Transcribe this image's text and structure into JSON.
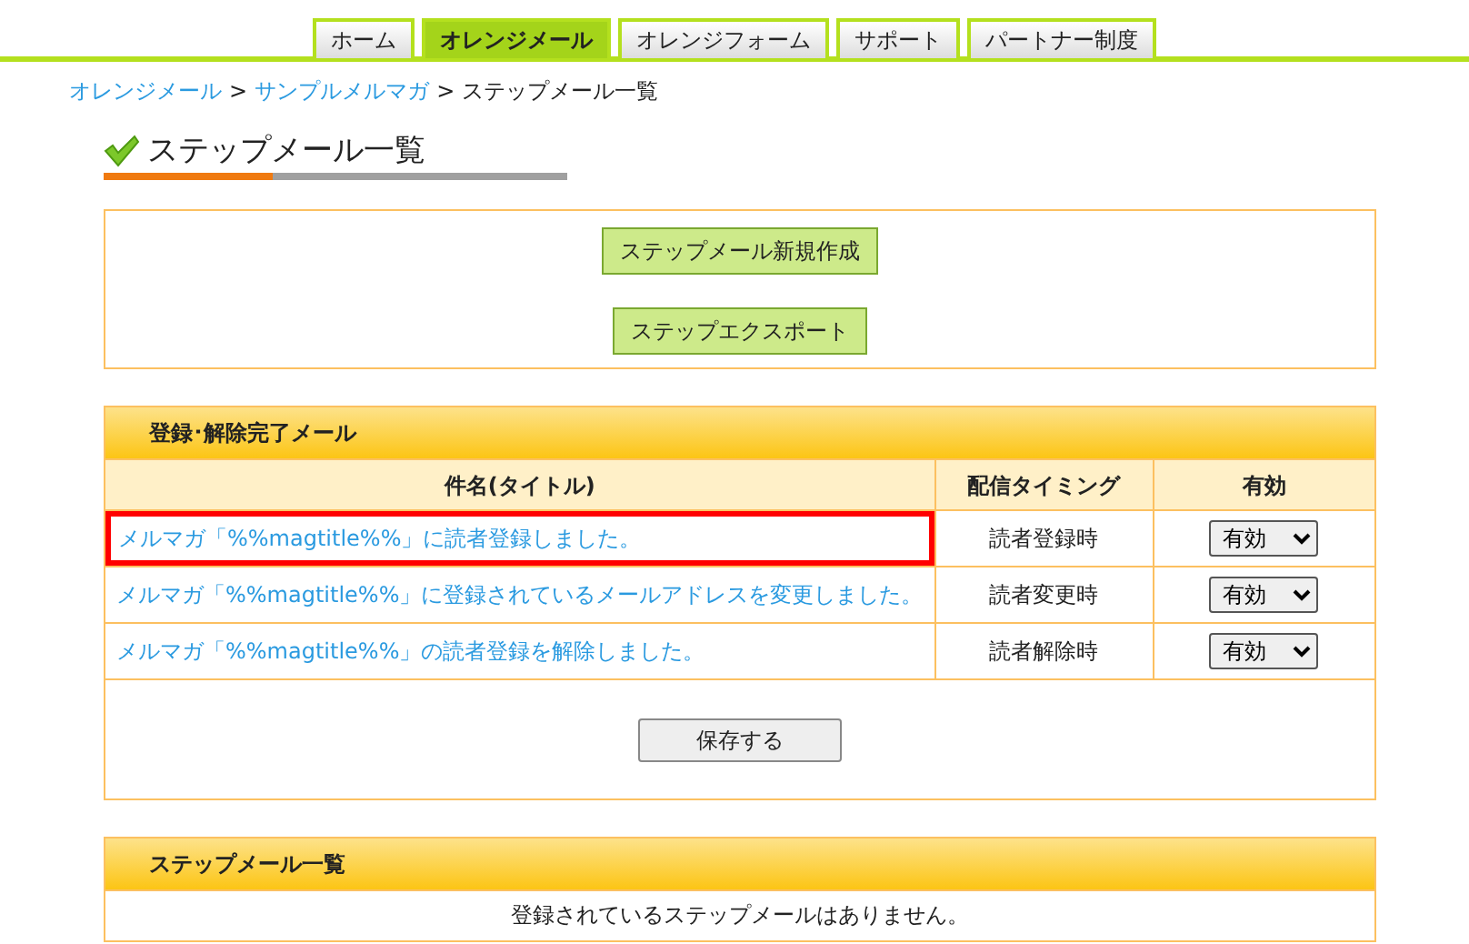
{
  "nav_tabs": [
    {
      "label": "ホーム",
      "selected": false
    },
    {
      "label": "オレンジメール",
      "selected": true
    },
    {
      "label": "オレンジフォーム",
      "selected": false
    },
    {
      "label": "サポート",
      "selected": false
    },
    {
      "label": "パートナー制度",
      "selected": false
    }
  ],
  "breadcrumb": [
    {
      "label": "オレンジメール",
      "kind": "link"
    },
    {
      "label": ">",
      "kind": "separator"
    },
    {
      "label": "サンプルメルマガ",
      "kind": "link"
    },
    {
      "label": ">",
      "kind": "separator"
    },
    {
      "label": "ステップメール一覧",
      "kind": "current"
    }
  ],
  "page_title": "ステップメール一覧",
  "actions": [
    "ステップメール新規作成",
    "ステップエクスポート"
  ],
  "completion_mail": {
    "title": "登録･解除完了メール",
    "columns": [
      "件名(タイトル)",
      "配信タイミング",
      "有効"
    ],
    "rows": [
      {
        "subject": "メルマガ「%%magtitle%%」に読者登録しました。",
        "timing": "読者登録時",
        "enabled": "有効",
        "highlighted": true
      },
      {
        "subject": "メルマガ「%%magtitle%%」に登録されているメールアドレスを変更しました。",
        "timing": "読者変更時",
        "enabled": "有効",
        "highlighted": false
      },
      {
        "subject": "メルマガ「%%magtitle%%」の読者登録を解除しました。",
        "timing": "読者解除時",
        "enabled": "有効",
        "highlighted": false
      }
    ],
    "save_button": "保存する"
  },
  "step_mail_list": {
    "title": "ステップメール一覧",
    "empty_message": "登録されているステップメールはありません。"
  }
}
